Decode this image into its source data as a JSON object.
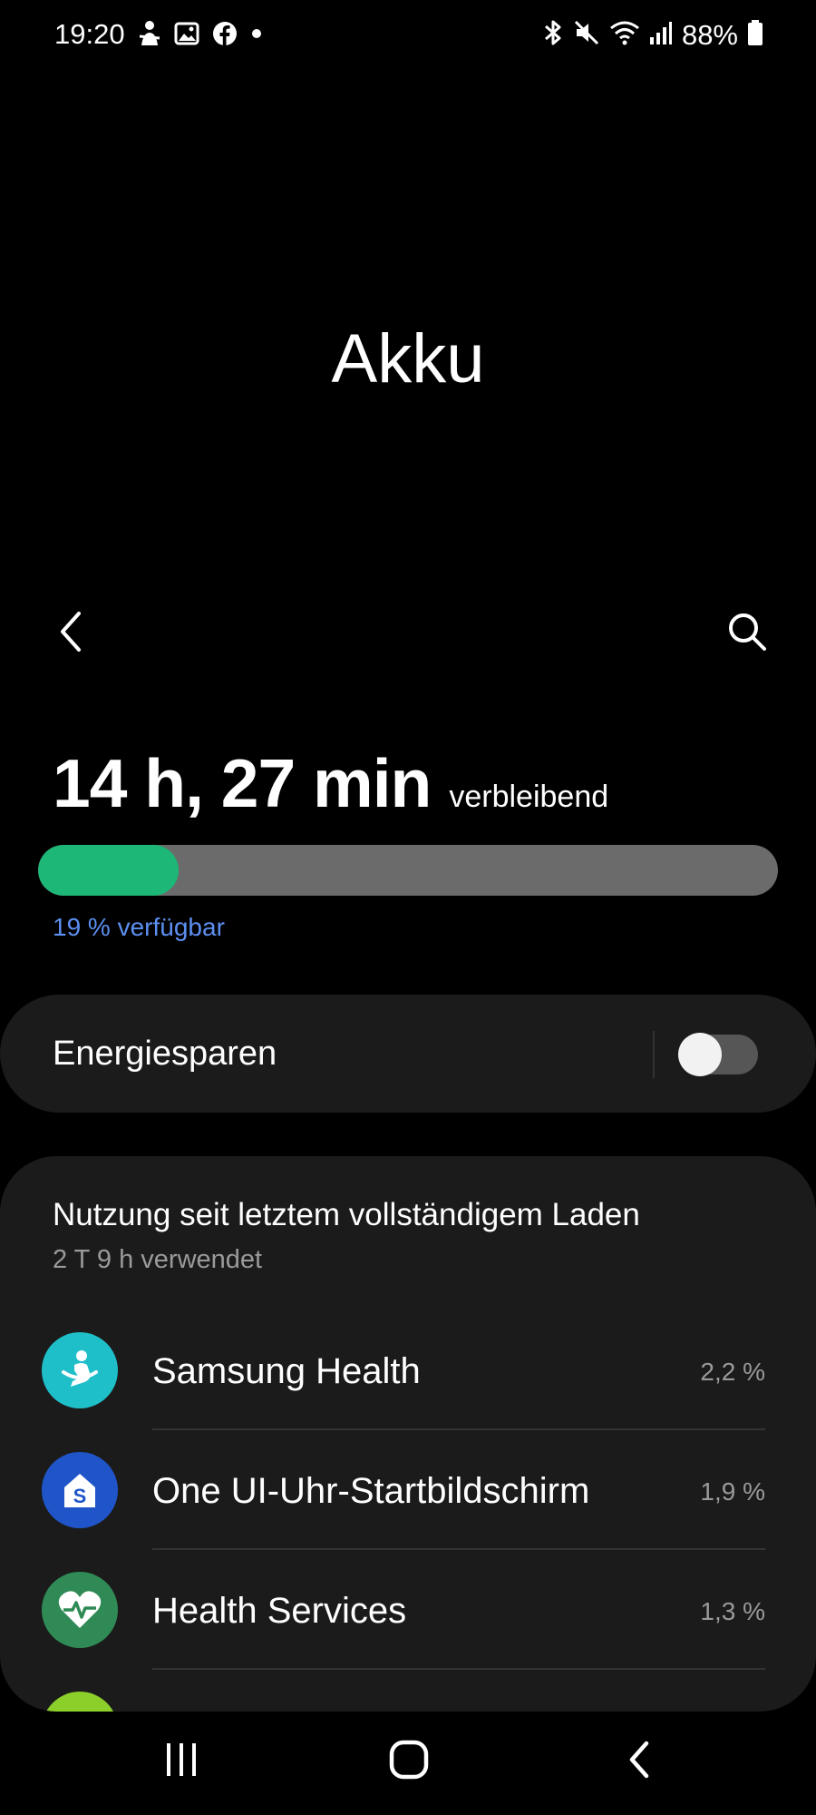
{
  "status_bar": {
    "time": "19:20",
    "battery_percent": "88%",
    "left_icons": [
      "figure-icon",
      "image-icon",
      "facebook-icon",
      "dot-icon"
    ],
    "right_icons": [
      "bluetooth-icon",
      "mute-icon",
      "wifi-icon",
      "signal-icon",
      "battery-icon"
    ]
  },
  "page": {
    "title": "Akku"
  },
  "toolbar": {
    "back_icon": "chevron-left-icon",
    "search_icon": "search-icon"
  },
  "battery": {
    "remaining_time": "14 h, 27 min",
    "remaining_label": "verbleibend",
    "level_fraction": 0.19,
    "available_text": "19 % verfügbar",
    "fill_color": "#1db777",
    "track_color": "#6b6b6b",
    "accent_text_color": "#5c8ff0"
  },
  "power_saving": {
    "label": "Energiesparen",
    "enabled": false
  },
  "usage": {
    "title": "Nutzung seit letztem vollständigem Laden",
    "subtitle": "2 T 9 h verwendet",
    "apps": [
      {
        "name": "Samsung Health",
        "percent": "2,2 %",
        "icon": "samsung-health-icon",
        "color": "#1fbfc9"
      },
      {
        "name": "One UI-Uhr-Startbildschirm",
        "percent": "1,9 %",
        "icon": "one-ui-watch-home-icon",
        "color": "#1f55c9"
      },
      {
        "name": "Health Services",
        "percent": "1,3 %",
        "icon": "heartbeat-icon",
        "color": "#2f8a55"
      }
    ],
    "partial_next_icon_color": "#8ccf2a"
  },
  "nav_bar": {
    "recents_icon": "recents-icon",
    "home_icon": "home-icon",
    "back_icon": "back-icon"
  }
}
